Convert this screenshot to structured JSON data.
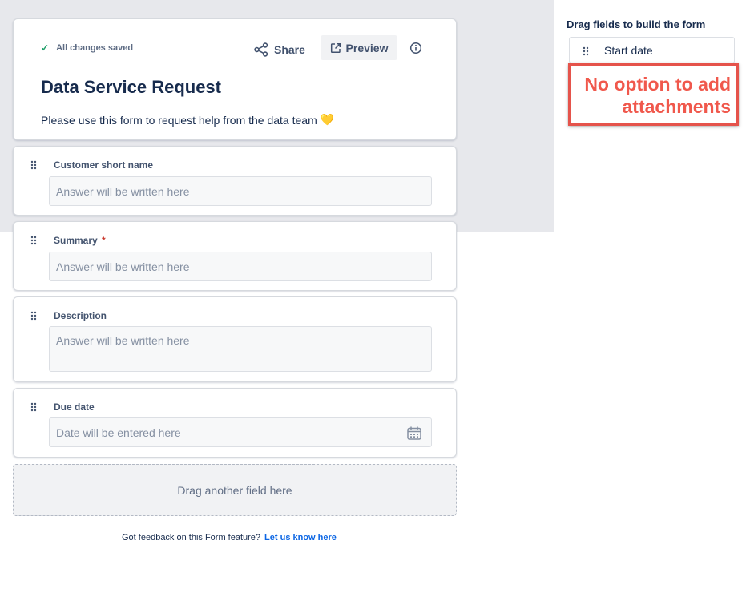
{
  "header": {
    "saved_status": "All changes saved",
    "share_label": "Share",
    "preview_label": "Preview",
    "title": "Data Service Request",
    "description": "Please use this form to request help from the data team",
    "description_emoji": "💛"
  },
  "fields": [
    {
      "label": "Customer short name",
      "required": false,
      "placeholder": "Answer will be written here"
    },
    {
      "label": "Summary",
      "required": true,
      "required_marker": "*",
      "placeholder": "Answer will be written here"
    },
    {
      "label": "Description",
      "required": false,
      "placeholder": "Answer will be written here"
    },
    {
      "label": "Due date",
      "required": false,
      "placeholder": "Date will be entered here"
    }
  ],
  "drop_zone": {
    "label": "Drag another field here"
  },
  "feedback": {
    "text": "Got feedback on this Form feature?",
    "link": "Let us know here"
  },
  "panel": {
    "title": "Drag fields to build the form",
    "available_fields": [
      "Start date"
    ]
  },
  "annotation": {
    "line1": "No option to add",
    "line2": "attachments"
  },
  "colors": {
    "accent": "#0c66e4",
    "success": "#22a06b",
    "required": "#c9372c",
    "annotation": "#e5534b"
  },
  "icons": {
    "saved": "check-icon",
    "share": "share-icon",
    "preview": "external-link-icon",
    "info": "info-icon",
    "drag": "drag-handle-icon",
    "date": "calendar-icon"
  }
}
